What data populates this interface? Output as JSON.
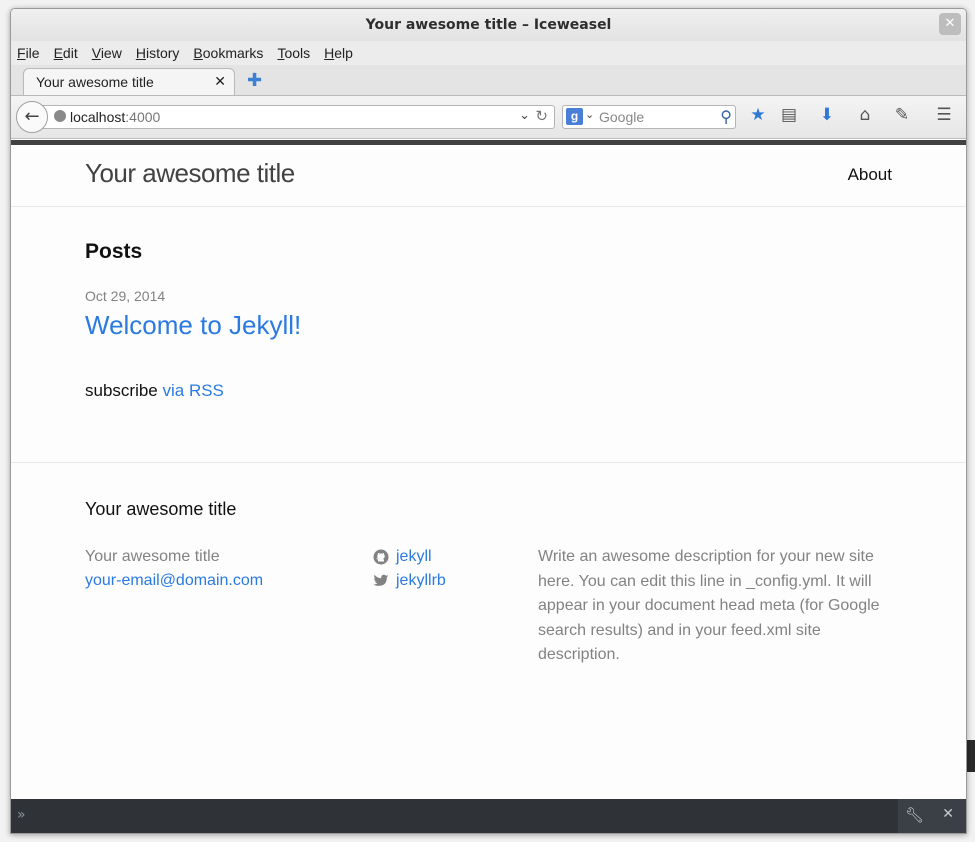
{
  "window": {
    "title": "Your awesome title – Iceweasel"
  },
  "menubar": [
    {
      "u": "F",
      "rest": "ile"
    },
    {
      "u": "E",
      "rest": "dit"
    },
    {
      "u": "V",
      "rest": "iew"
    },
    {
      "u": "H",
      "rest": "istory"
    },
    {
      "u": "B",
      "rest": "ookmarks"
    },
    {
      "u": "T",
      "rest": "ools"
    },
    {
      "u": "H",
      "rest": "elp"
    }
  ],
  "tab": {
    "label": "Your awesome title"
  },
  "url": {
    "host": "localhost",
    "port": ":4000"
  },
  "search": {
    "placeholder": "Google"
  },
  "site": {
    "title": "Your awesome title",
    "nav_about": "About",
    "posts_heading": "Posts",
    "post_date": "Oct 29, 2014",
    "post_title": "Welcome to Jekyll!",
    "subscribe": "subscribe ",
    "rss_link": "via RSS"
  },
  "footer": {
    "heading": "Your awesome title",
    "name": "Your awesome title",
    "email": "your-email@domain.com",
    "github": "jekyll",
    "twitter": "jekyllrb",
    "description": "Write an awesome description for your new site here. You can edit this line in _config.yml. It will appear in your document head meta (for Google search results) and in your feed.xml site description."
  },
  "colors": {
    "link": "#2a7ae2",
    "header_bar": "#424242",
    "meta": "#828282"
  }
}
